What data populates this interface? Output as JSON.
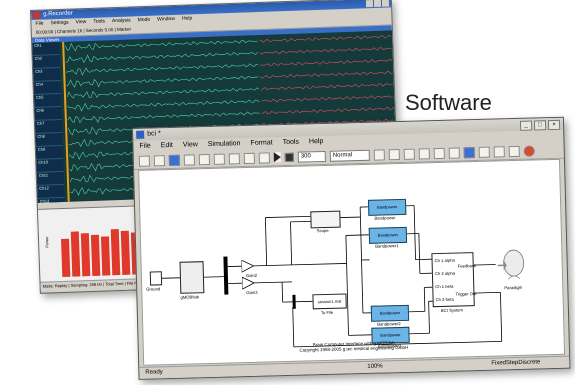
{
  "caption": "Software",
  "recorder": {
    "title": "g.Recorder",
    "menu": [
      "File",
      "Settings",
      "View",
      "Tools",
      "Analysis",
      "Mode",
      "Window",
      "Help"
    ],
    "toolbar_text": "00:00:00 | Channels 16 | Seconds 5.00 | Marker",
    "subtitle": "Data Viewer",
    "channel_labels": [
      "Ch1",
      "Ch2",
      "Ch3",
      "Ch4",
      "Ch5",
      "Ch6",
      "Ch7",
      "Ch8",
      "Ch9",
      "Ch10",
      "Ch11",
      "Ch12",
      "Ch13"
    ],
    "bar_ylabel": "Power",
    "status": "Mode: Replay | Sampling: 256 Hz | Total Time | File Name"
  },
  "simulink": {
    "title": "bci *",
    "menu": [
      "File",
      "Edit",
      "View",
      "Simulation",
      "Format",
      "Tools",
      "Help"
    ],
    "stop_time": "300",
    "sim_mode": "Normal",
    "blocks": {
      "ground": "Ground",
      "gmobilab": "gMOBIlab",
      "gain2": "Gain2",
      "gain3": "Gain3",
      "scope": "Scope",
      "tofile_inner": "session1.mat",
      "tofile": "To File",
      "bp": [
        "Bandpower",
        "Bandpower1",
        "Bandpower2",
        "Bandpower3"
      ],
      "bp_inner": "Bandpower",
      "bci_system": "BCI System",
      "bci_inputs": [
        "Ch 1 alpha",
        "Ch 2 alpha",
        "Ch 1 beta",
        "Ch 2 beta"
      ],
      "bci_outputs": [
        "Feedback",
        "Trigger Out"
      ],
      "paradigm": "Paradigm"
    },
    "footer_line1": "Brain Computer Interface with g.MOBIlab",
    "footer_line2": "Copyright 1998-2005 g.tec medical engineering GmbH",
    "status_left": "Ready",
    "status_mid": "100%",
    "status_right": "FixedStepDiscrete"
  }
}
